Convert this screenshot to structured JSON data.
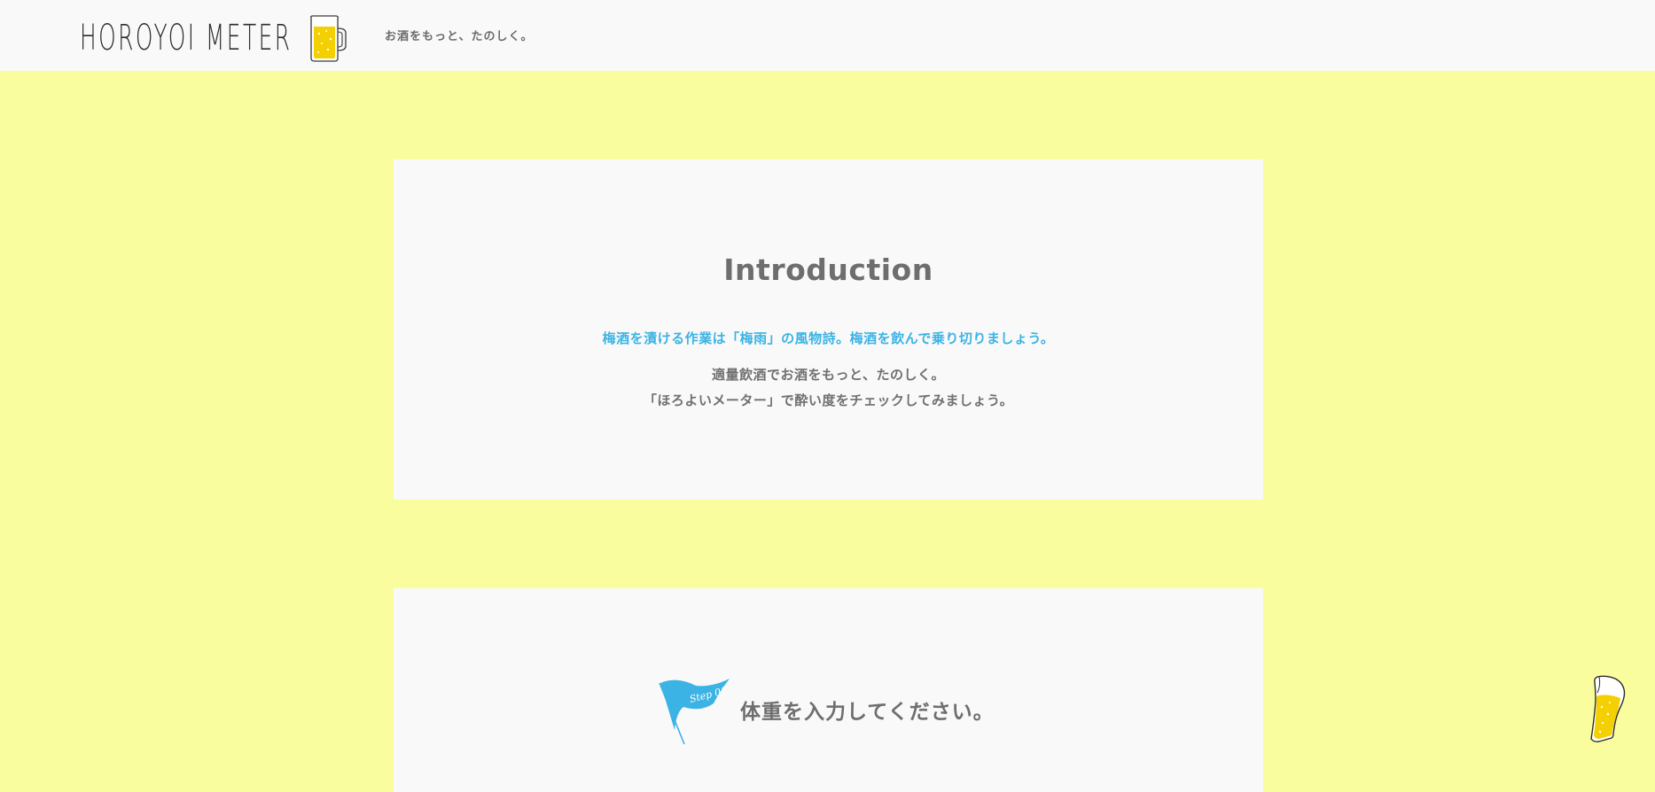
{
  "header": {
    "logo_text": "HOROYOI METER",
    "logo_icon": "beer-mug-icon",
    "tagline": "お酒をもっと、たのしく。"
  },
  "intro": {
    "title": "Introduction",
    "lead": "梅酒を漬ける作業は「梅雨」の風物詩。梅酒を飲んで乗り切りましょう。",
    "body": [
      "適量飲酒でお酒をもっと、たのしく。",
      "「ほろよいメーター」で酔い度をチェックしてみましょう。"
    ]
  },
  "step1": {
    "flag_label": "Step 01",
    "flag_icon": "flag-icon",
    "title": "体重を入力してください。"
  },
  "floating_button": {
    "icon": "beer-glass-icon"
  },
  "colors": {
    "background": "#f9fd9e",
    "card": "#f9f9f9",
    "accent_blue": "#3bb3e4",
    "beer_yellow": "#f5d000",
    "text_gray": "#6e6e6e"
  }
}
